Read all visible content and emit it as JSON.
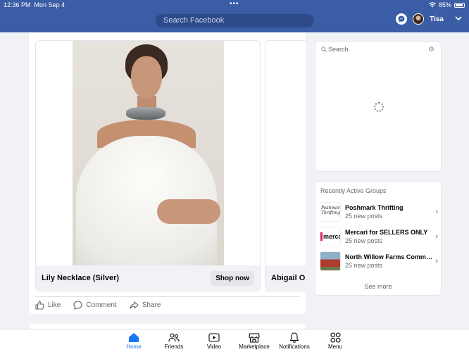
{
  "status": {
    "time": "12:36 PM",
    "date": "Mon Sep 4",
    "battery": "85%"
  },
  "header": {
    "search_placeholder": "Search Facebook",
    "user_name": "Tisa"
  },
  "feed": {
    "carousel": [
      {
        "title": "Lily Necklace (Silver)",
        "cta": "Shop now"
      },
      {
        "title": "Abigail One"
      }
    ],
    "actions": {
      "like": "Like",
      "comment": "Comment",
      "share": "Share"
    }
  },
  "right_search": {
    "placeholder": "Search"
  },
  "groups": {
    "title": "Recently Active Groups",
    "items": [
      {
        "name": "Poshmark Thrifting",
        "sub": "25 new posts",
        "thumb_text": "Poshmark Thrifting"
      },
      {
        "name": "Mercari for SELLERS ONLY",
        "sub": "25 new posts",
        "thumb_text": "merca"
      },
      {
        "name": "North Willow Farms Commun...",
        "sub": "25 new posts"
      }
    ],
    "see_more": "See more"
  },
  "tabs": [
    "Home",
    "Friends",
    "Video",
    "Marketplace",
    "Notifications",
    "Menu"
  ],
  "colors": {
    "header": "#3b5da6",
    "accent": "#1877f2"
  }
}
